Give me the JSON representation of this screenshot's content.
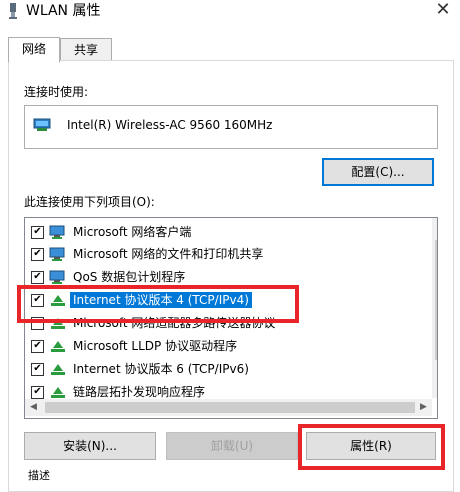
{
  "window": {
    "title": "WLAN 属性",
    "close_symbol": "✕"
  },
  "tabs": [
    {
      "label": "网络"
    },
    {
      "label": "共享"
    }
  ],
  "connect_using": {
    "label": "连接时使用:",
    "adapter": "Intel(R) Wireless-AC 9560 160MHz",
    "configure_button": "配置(C)..."
  },
  "items": {
    "label": "此连接使用下列项目(O):",
    "list": [
      {
        "text": "Microsoft 网络客户端",
        "checked": true,
        "icon": "network-client-icon"
      },
      {
        "text": "Microsoft 网络的文件和打印机共享",
        "checked": true,
        "icon": "file-printer-sharing-icon"
      },
      {
        "text": "QoS 数据包计划程序",
        "checked": true,
        "icon": "qos-scheduler-icon"
      },
      {
        "text": "Internet 协议版本 4 (TCP/IPv4)",
        "checked": true,
        "icon": "protocol-icon",
        "selected": true
      },
      {
        "text": "Microsoft 网络适配器多路传送器协议",
        "checked": false,
        "icon": "protocol-icon"
      },
      {
        "text": "Microsoft LLDP 协议驱动程序",
        "checked": true,
        "icon": "protocol-icon"
      },
      {
        "text": "Internet 协议版本 6 (TCP/IPv6)",
        "checked": true,
        "icon": "protocol-icon"
      },
      {
        "text": "链路层拓扑发现响应程序",
        "checked": true,
        "icon": "protocol-icon"
      }
    ]
  },
  "buttons": {
    "install": "安装(N)...",
    "uninstall": "卸载(U)",
    "properties": "属性(R)"
  },
  "description_label": "描述",
  "colors": {
    "highlight": "#e8262a",
    "selection": "#0078d7"
  }
}
